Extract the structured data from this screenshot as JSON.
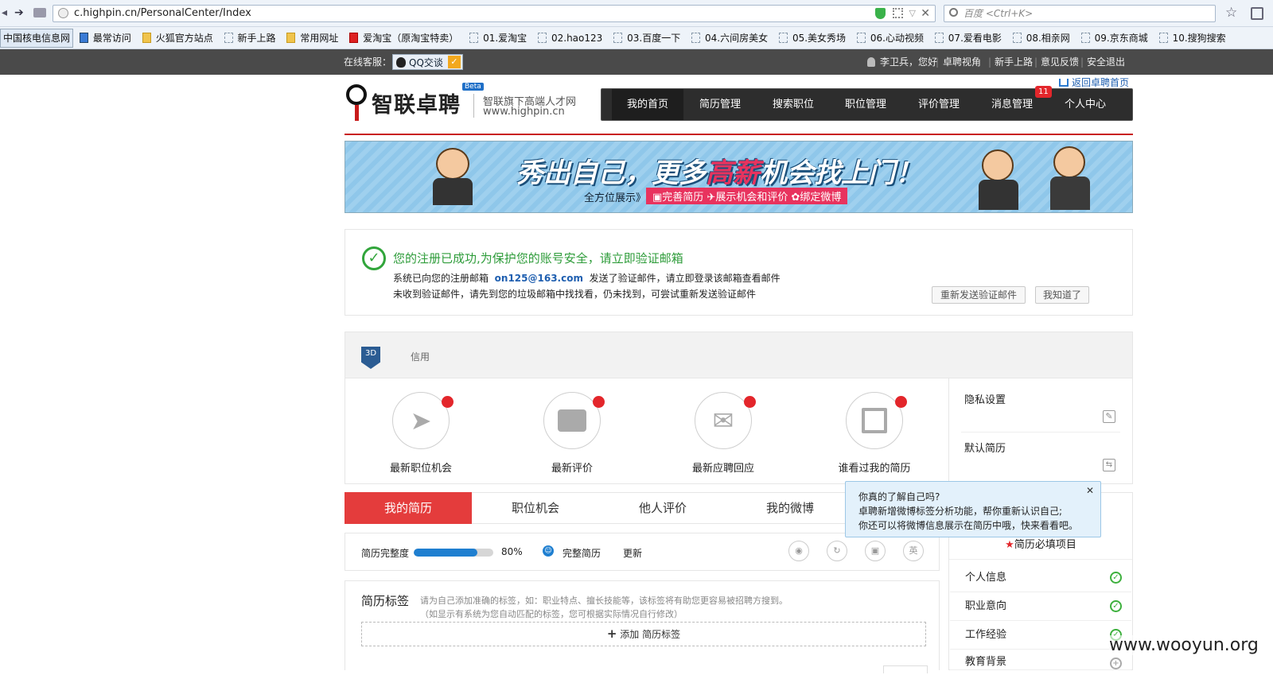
{
  "browser": {
    "url": "c.highpin.cn/PersonalCenter/Index",
    "search_placeholder": "百度 <Ctrl+K>",
    "bookmarks": [
      "中国核电信息网",
      "最常访问",
      "火狐官方站点",
      "新手上路",
      "常用网址",
      "爱淘宝（原淘宝特卖）",
      "01.爱淘宝",
      "02.hao123",
      "03.百度一下",
      "04.六间房美女",
      "05.美女秀场",
      "06.心动视频",
      "07.爱看电影",
      "08.相亲网",
      "09.京东商城",
      "10.搜狗搜索"
    ]
  },
  "sitebar": {
    "service_label": "在线客服：",
    "qq_label": "QQ交谈",
    "greeting": "李卫兵，您好",
    "links": [
      "卓聘视角",
      "新手上路",
      "意见反馈",
      "安全退出"
    ]
  },
  "header": {
    "logo_text": "智联卓聘",
    "logo_badge": "Beta",
    "tagline": "智联旗下高端人才网",
    "site": "www.highpin.cn",
    "back_home": "返回卓聘首页",
    "menu": [
      "我的首页",
      "简历管理",
      "搜索职位",
      "职位管理",
      "评价管理",
      "消息管理",
      "个人中心"
    ],
    "message_badge": "11"
  },
  "banner": {
    "headline_1": "秀出自己，更多",
    "headline_hl": "高薪",
    "headline_2": "机会找上门！",
    "sub_label": "全方位展示》",
    "sub_items": "完善简历 ✈展示机会和评价 ✿绑定微博"
  },
  "notice": {
    "title": "您的注册已成功,为保护您的账号安全，请立即验证邮箱",
    "line1_pre": "系统已向您的注册邮箱",
    "email": "on125@163.com",
    "line1_post": "发送了验证邮件，请立即登录该邮箱查看邮件",
    "line2": "未收到验证邮件，请先到您的垃圾邮箱中找找看，仍未找到，可尝试重新发送验证邮件",
    "resend": "重新发送验证邮件",
    "ok": "我知道了"
  },
  "credit": {
    "badge": "3D",
    "label": "信用"
  },
  "quick": [
    {
      "label": "最新职位机会",
      "icon": "paper-plane-icon"
    },
    {
      "label": "最新评价",
      "icon": "comment-icon"
    },
    {
      "label": "最新应聘回应",
      "icon": "envelope-icon"
    },
    {
      "label": "谁看过我的简历",
      "icon": "document-icon"
    }
  ],
  "side": {
    "privacy": "隐私设置",
    "default_resume": "默认简历",
    "required_title": "简历必填项目",
    "required": [
      "个人信息",
      "职业意向",
      "工作经验",
      "教育背景"
    ]
  },
  "tabs": [
    "我的简历",
    "职位机会",
    "他人评价",
    "我的微博"
  ],
  "tooltip": {
    "title": "你真的了解自己吗?",
    "line1": "卓聘新增微博标签分析功能，帮你重新认识自己;",
    "line2": "你还可以将微博信息展示在简历中哦，快来看看吧。"
  },
  "resume": {
    "complete_label": "简历完整度",
    "progress": 80,
    "progress_text": "80%",
    "complete_link": "完整简历",
    "update_link": "更新",
    "tools": [
      "eye-icon",
      "refresh-icon",
      "save-icon",
      "英"
    ]
  },
  "tags": {
    "title": "简历标签",
    "hint1": "请为自己添加准确的标签，如：职业特点、擅长技能等，该标签将有助您更容易被招聘方搜到。",
    "hint2": "（如显示有系统为您自动匹配的标签，您可根据实际情况自行修改）",
    "add": "添加 简历标签"
  },
  "watermark": "www.wooyun.org"
}
